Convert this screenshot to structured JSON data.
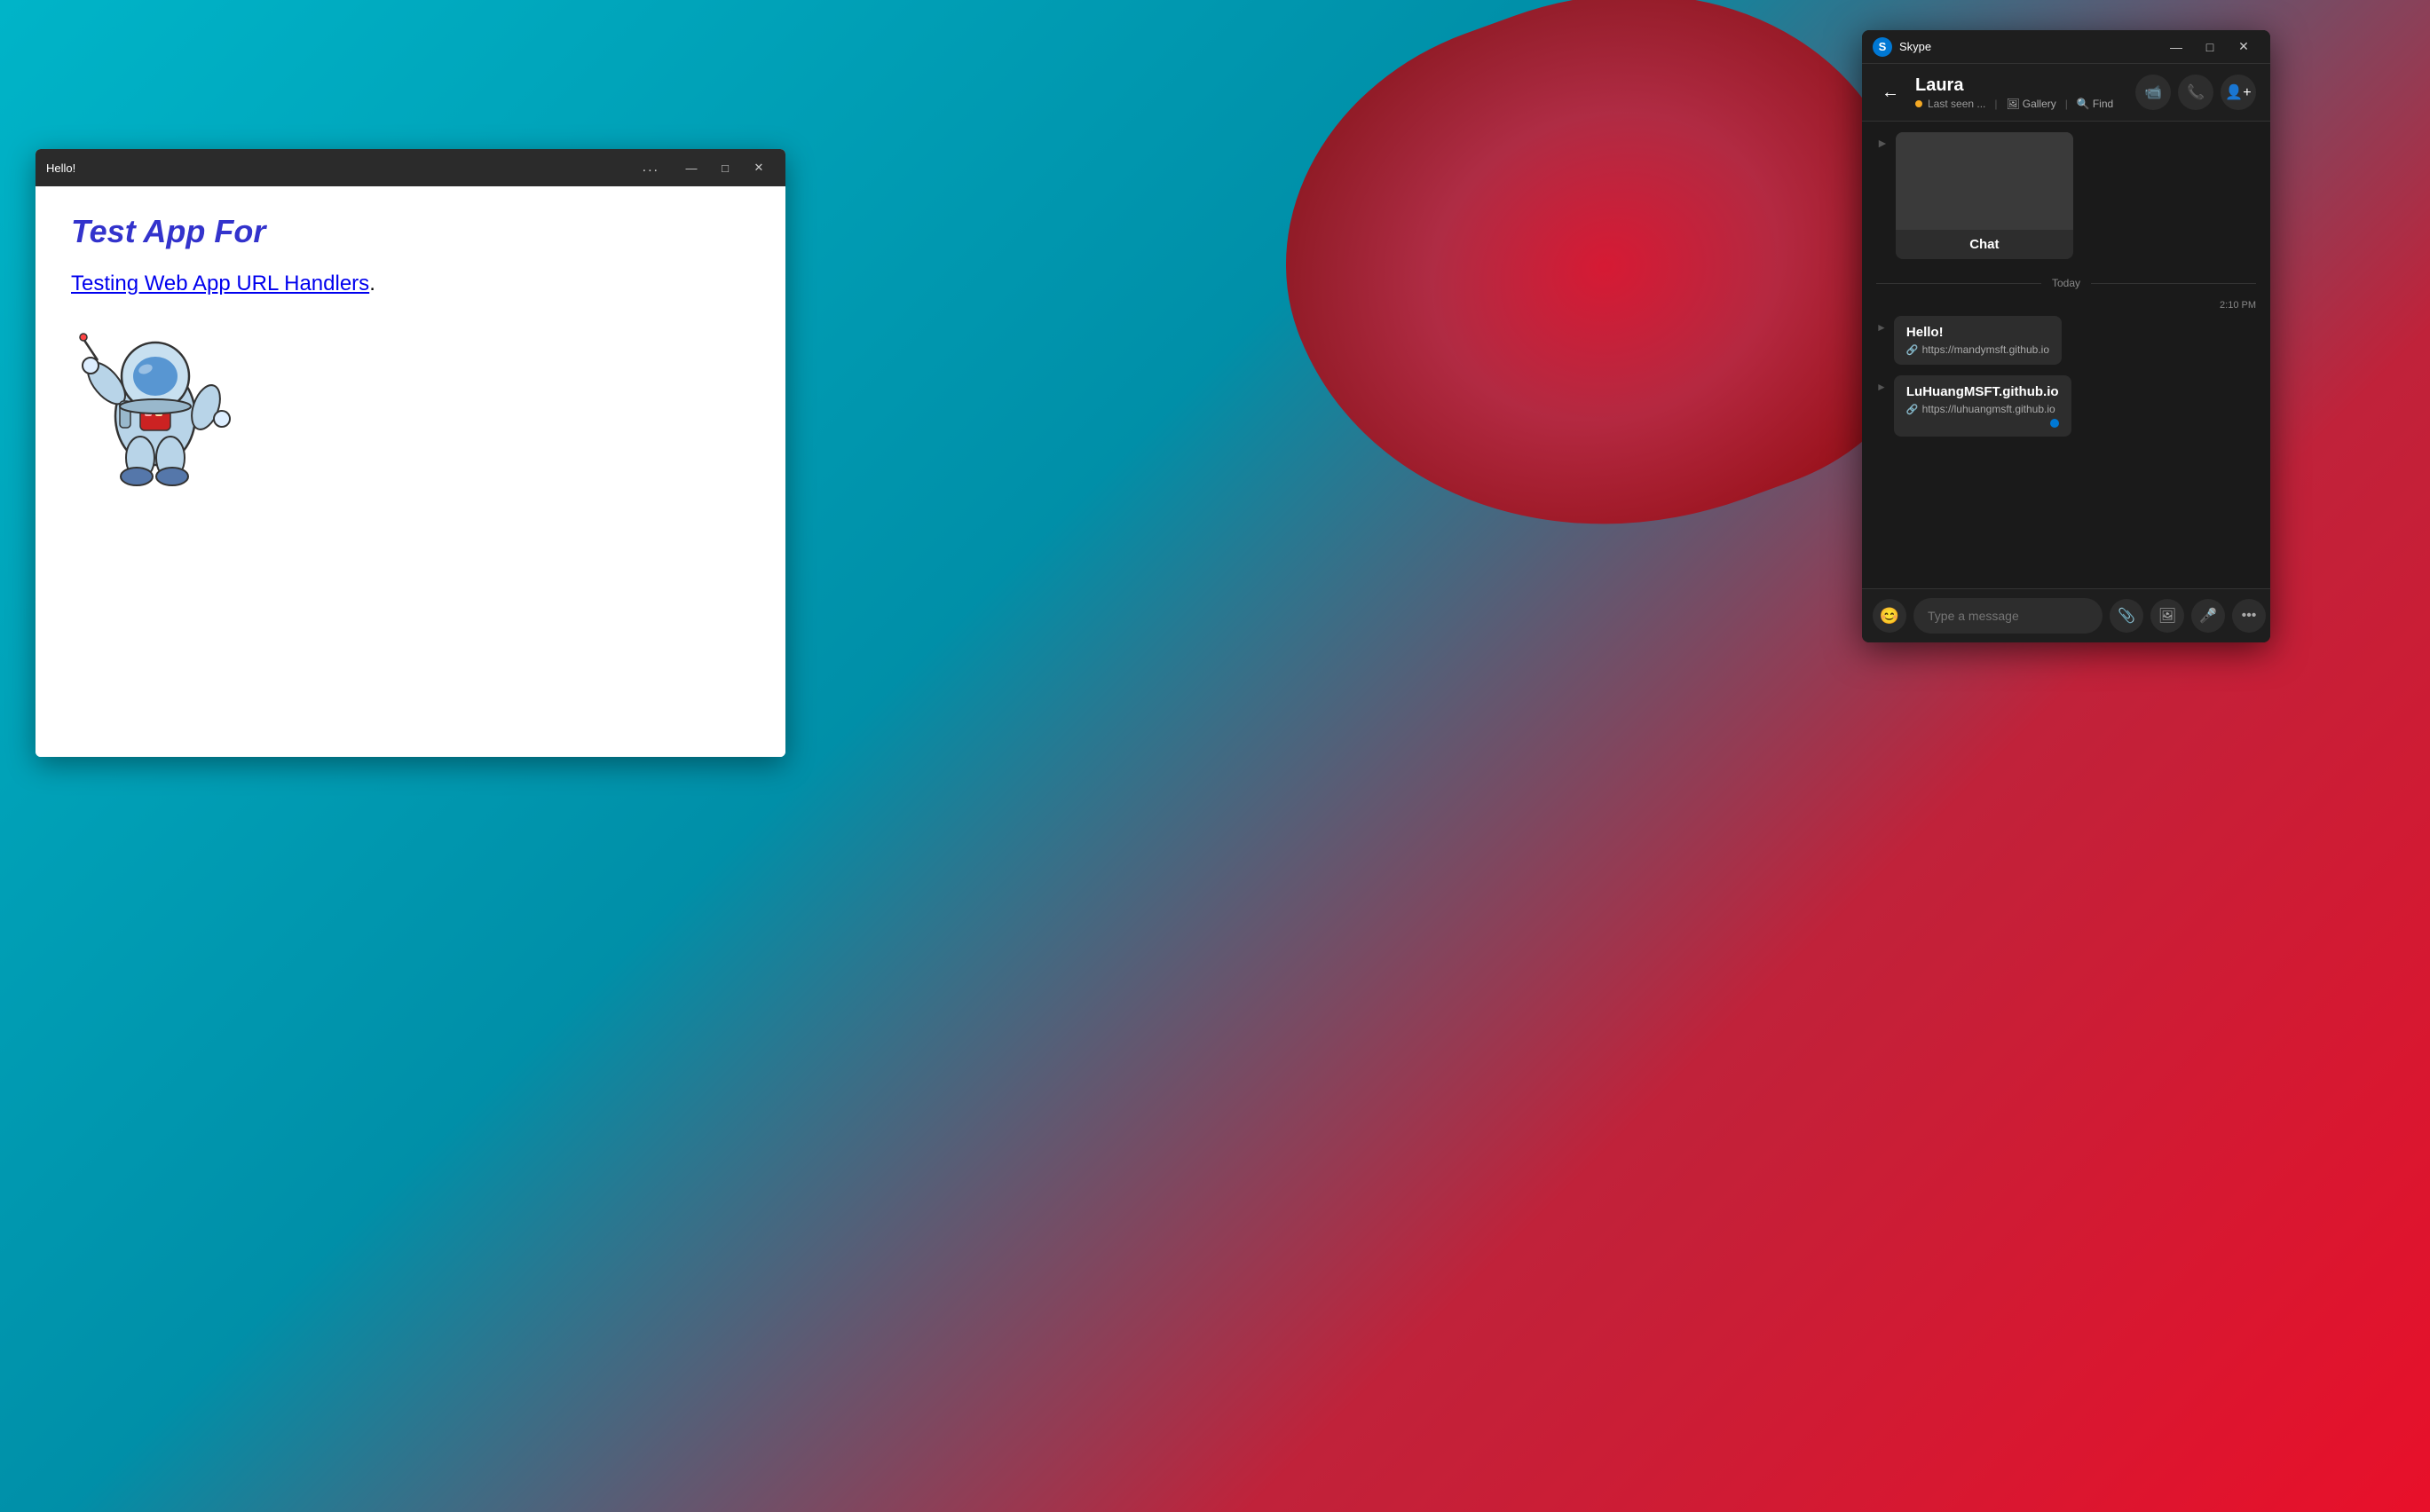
{
  "desktop": {
    "background_desc": "teal and red floral background"
  },
  "hello_window": {
    "title": "Hello!",
    "dots_label": "...",
    "minimize_label": "—",
    "maximize_label": "□",
    "close_label": "✕",
    "heading": "Test App For",
    "link_text": "Testing Web App URL Handlers",
    "link_suffix": "."
  },
  "skype_window": {
    "title": "Skype",
    "minimize_label": "—",
    "maximize_label": "□",
    "close_label": "✕",
    "contact_name": "Laura",
    "status_text": "Last seen ...",
    "gallery_label": "Gallery",
    "find_label": "Find",
    "today_label": "Today",
    "timestamp": "2:10 PM",
    "preview_card_label": "Chat",
    "messages": [
      {
        "text": "Hello!",
        "link": "https://mandymsft.github.io",
        "has_blue_dot": false
      },
      {
        "text": "LuHuangMSFT.github.io",
        "link": "https://luhuangmsft.github.io",
        "has_blue_dot": true
      }
    ],
    "input_placeholder": "Type a message"
  }
}
